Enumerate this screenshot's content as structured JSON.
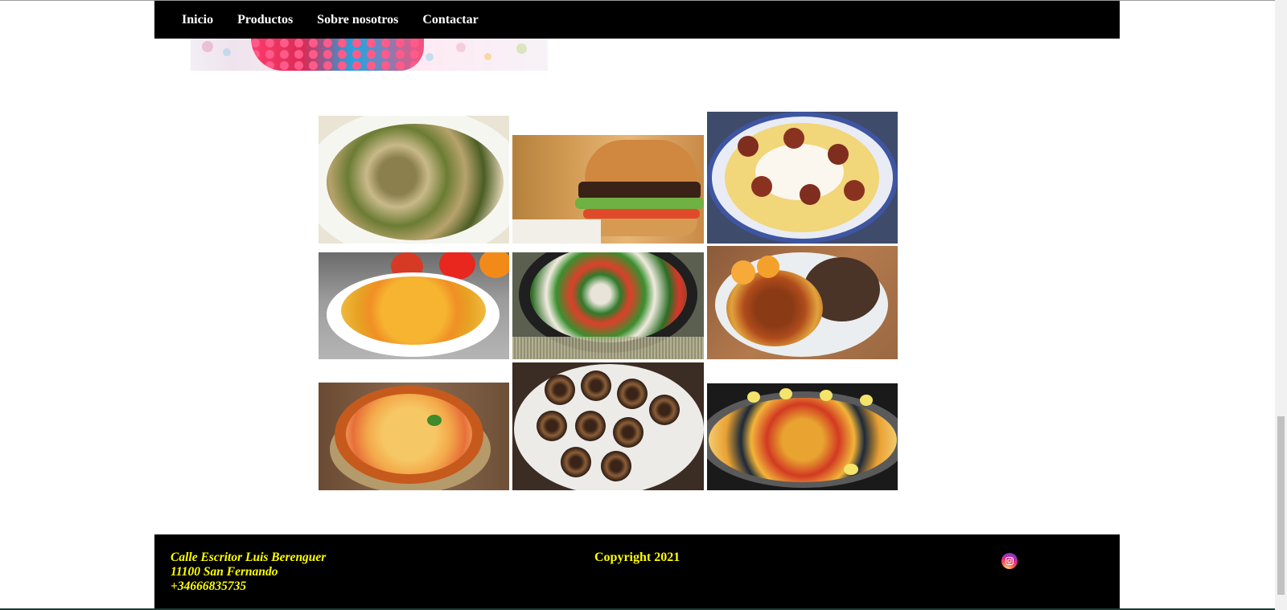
{
  "nav": {
    "items": [
      {
        "label": "Inicio"
      },
      {
        "label": "Productos"
      },
      {
        "label": "Sobre nosotros"
      },
      {
        "label": "Contactar"
      }
    ]
  },
  "gallery": {
    "items": [
      {
        "name": "mushroom-dish-image"
      },
      {
        "name": "burger-image"
      },
      {
        "name": "fries-chorizo-egg-image"
      },
      {
        "name": "rice-vegetables-image"
      },
      {
        "name": "stir-fry-image"
      },
      {
        "name": "meat-peppers-plate-image"
      },
      {
        "name": "clay-pot-eggs-image"
      },
      {
        "name": "snails-image"
      },
      {
        "name": "paella-image"
      }
    ]
  },
  "footer": {
    "address_line1": "Calle Escritor Luis Berenguer",
    "address_line2": "11100 San Fernando",
    "phone": "+34666835735",
    "copyright": "Copyright 2021",
    "social_icon": "instagram-icon"
  }
}
